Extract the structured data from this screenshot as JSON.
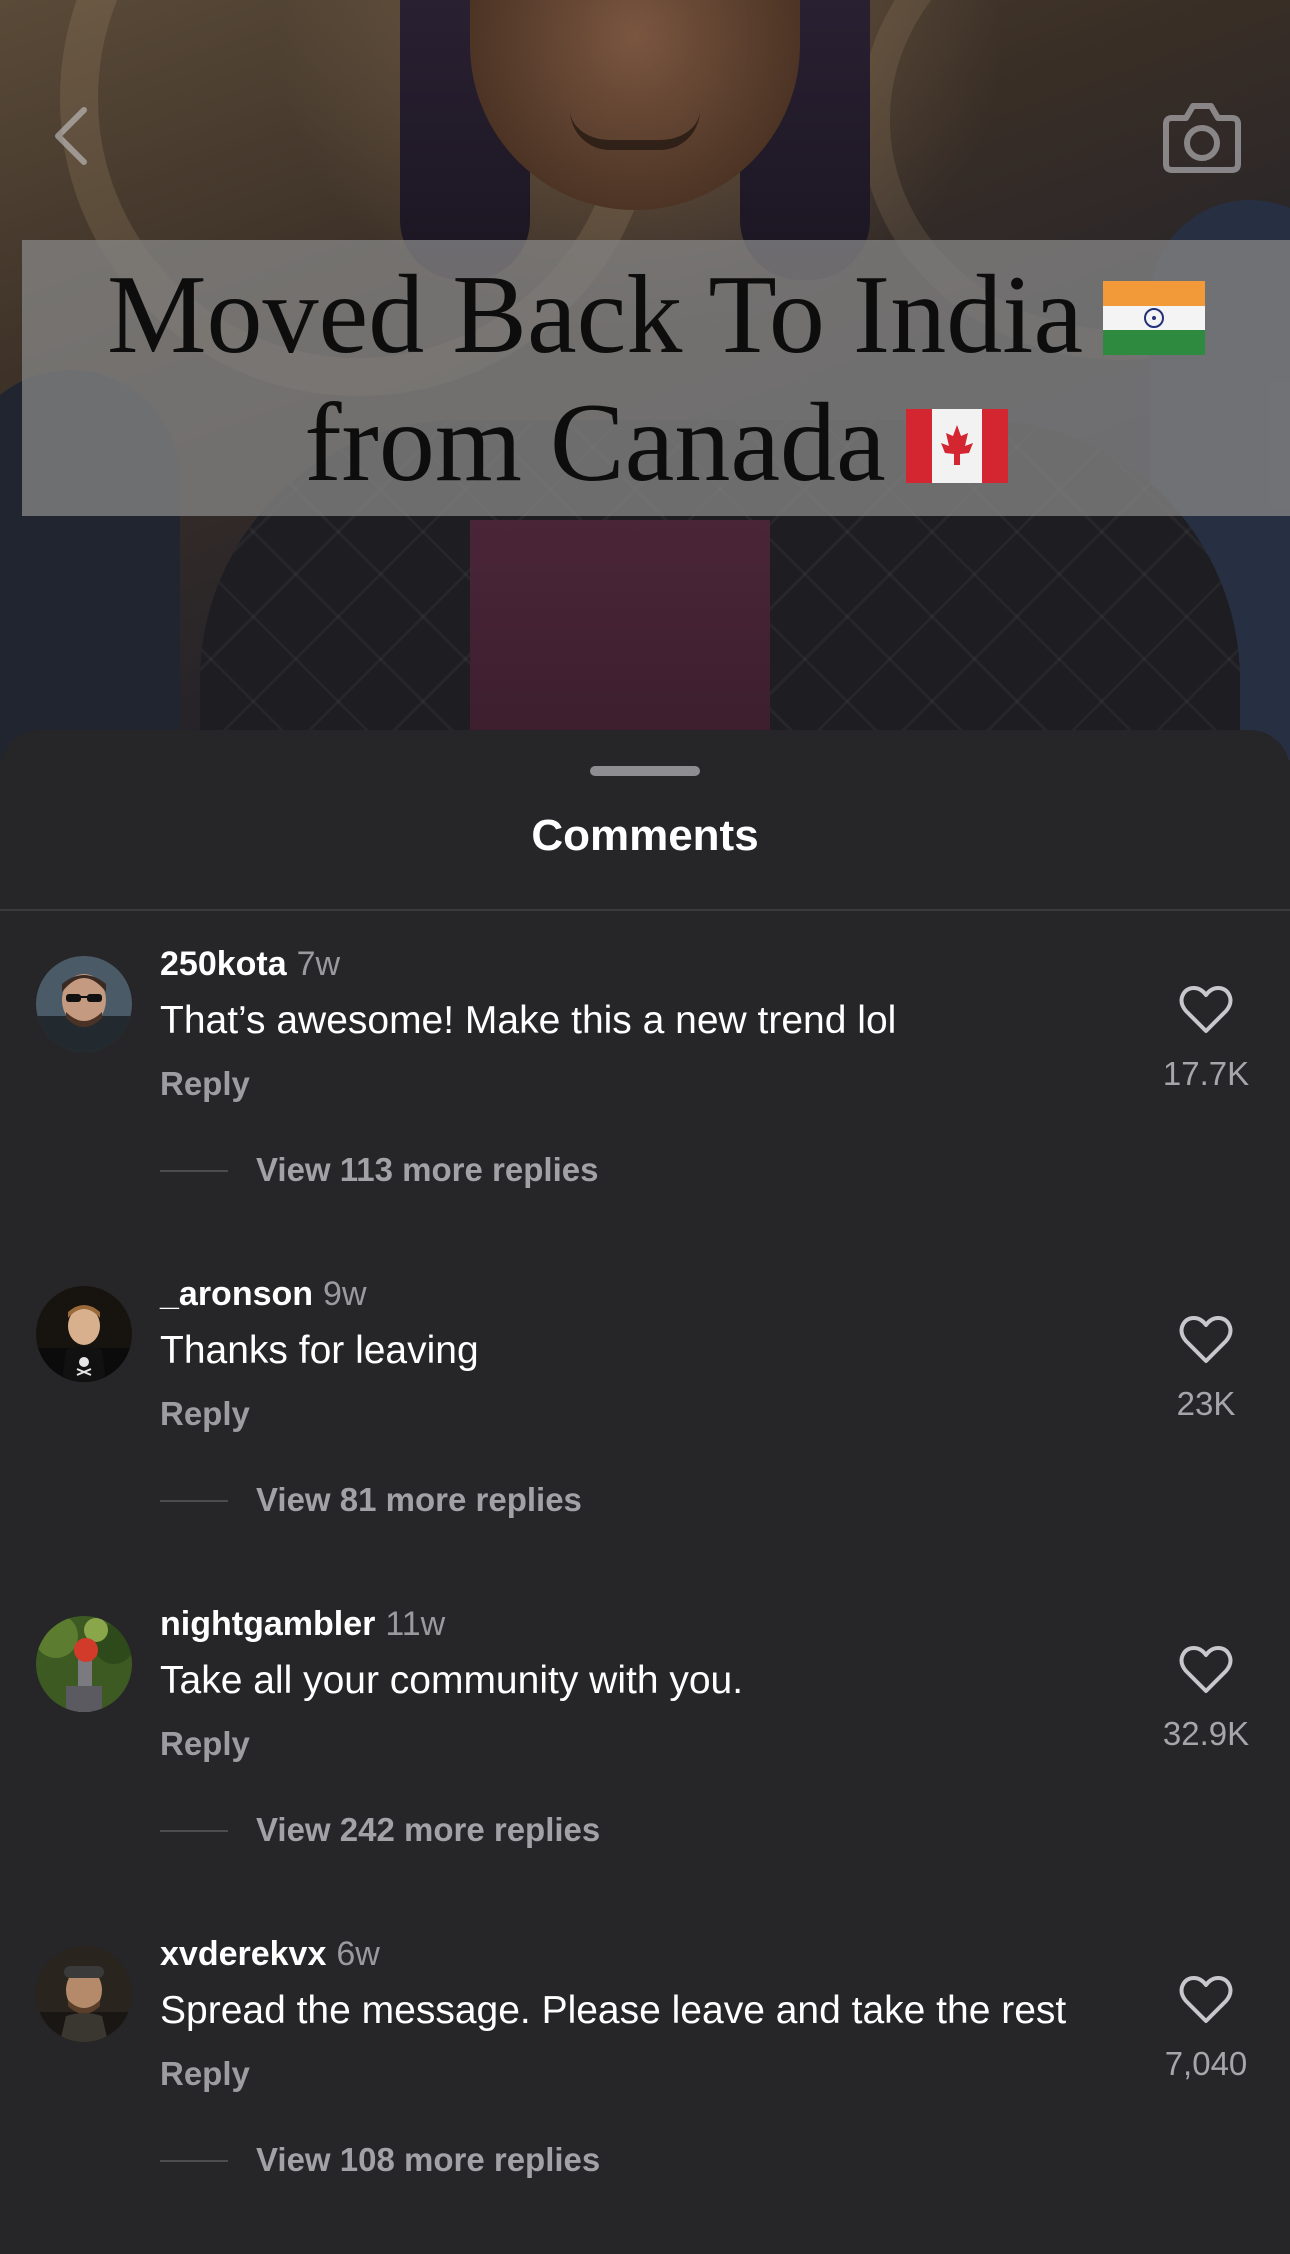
{
  "video": {
    "title_line1": "Moved Back To India",
    "title_line2": "from Canada",
    "flag1": "india-flag",
    "flag2": "canada-flag"
  },
  "top_bar": {
    "back_icon": "chevron-left-icon",
    "camera_icon": "camera-icon"
  },
  "sheet": {
    "title": "Comments"
  },
  "comments": [
    {
      "username": "250kota",
      "time": "7w",
      "text": "That’s awesome! Make this a new trend lol",
      "reply_label": "Reply",
      "likes": "17.7K",
      "view_replies": "View 113 more replies"
    },
    {
      "username": "_aronson",
      "time": "9w",
      "text": "Thanks for leaving",
      "reply_label": "Reply",
      "likes": "23K",
      "view_replies": "View 81 more replies"
    },
    {
      "username": "nightgambler",
      "time": "11w",
      "text": "Take all your community with you.",
      "reply_label": "Reply",
      "likes": "32.9K",
      "view_replies": "View 242 more replies"
    },
    {
      "username": "xvderekvx",
      "time": "6w",
      "text": "Spread the message. Please leave and take the rest",
      "reply_label": "Reply",
      "likes": "7,040",
      "view_replies": "View 108 more replies"
    }
  ],
  "colors": {
    "sheet_background": "#262628",
    "primary_text": "#ffffff",
    "secondary_text": "#9d9da1"
  }
}
